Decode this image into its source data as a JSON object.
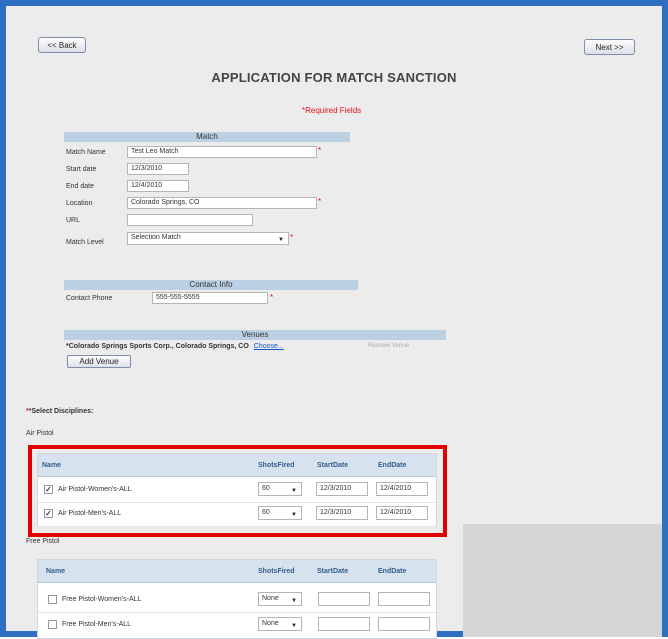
{
  "nav": {
    "back_label": "<< Back",
    "next_label": "Next >>"
  },
  "page_title": "APPLICATION FOR MATCH SANCTION",
  "required_note": "*Required Fields",
  "match": {
    "header": "Match",
    "name_label": "Match Name",
    "name_value": "Test Leo Match",
    "start_label": "Start date",
    "start_value": "12/3/2010",
    "end_label": "End date",
    "end_value": "12/4/2010",
    "location_label": "Location",
    "location_value": "Colorado Springs, CO",
    "url_label": "URL",
    "url_value": "",
    "level_label": "Match Level",
    "level_value": "Selection Match"
  },
  "contact": {
    "header": "Contact Info",
    "phone_label": "Contact Phone",
    "phone_value": "555-555-5555"
  },
  "venues": {
    "header": "Venues",
    "venue_text": "*Colorado Springs Sports Corp., Colorado Springs, CO",
    "choose_link": "Choose...",
    "remove_label": "Remove Venue",
    "add_label": "Add Venue"
  },
  "disciplines": {
    "select_label": "*Select Disciplines:",
    "air_pistol": {
      "group_label": "Air Pistol",
      "headers": {
        "name": "Name",
        "shots": "ShotsFired",
        "start": "StartDate",
        "end": "EndDate"
      },
      "rows": [
        {
          "name": "Air Pistol-Women's-ALL",
          "checked": "✓",
          "shots": "60",
          "start": "12/3/2010",
          "end": "12/4/2010"
        },
        {
          "name": "Air Pistol-Men's-ALL",
          "checked": "✓",
          "shots": "60",
          "start": "12/3/2010",
          "end": "12/4/2010"
        }
      ]
    },
    "free_pistol": {
      "group_label": "Free Pistol",
      "headers": {
        "name": "Name",
        "shots": "ShotsFired",
        "start": "StartDate",
        "end": "EndDate"
      },
      "rows": [
        {
          "name": "Free Pistol-Women's-ALL",
          "checked": "",
          "shots": "None",
          "start": "",
          "end": ""
        },
        {
          "name": "Free Pistol-Men's-ALL",
          "checked": "",
          "shots": "None",
          "start": "",
          "end": ""
        }
      ]
    }
  },
  "colors": {
    "frame": "#2e6fc3",
    "highlight": "#e00000",
    "required": "#e0141b",
    "band": "#bcd0e4"
  }
}
